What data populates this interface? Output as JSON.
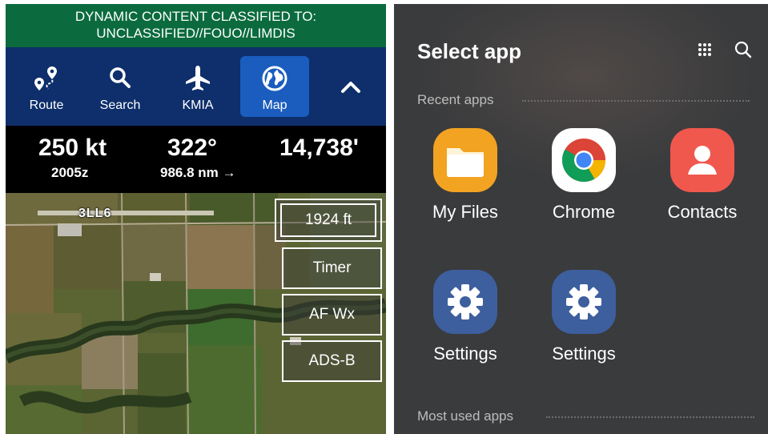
{
  "banner": {
    "line1": "DYNAMIC CONTENT CLASSIFIED TO:",
    "line2": "UNCLASSIFIED//FOUO//LIMDIS"
  },
  "toolbar": {
    "buttons": [
      {
        "label": "Route",
        "icon": "route-icon"
      },
      {
        "label": "Search",
        "icon": "search-icon"
      },
      {
        "label": "KMIA",
        "icon": "airplane-icon"
      },
      {
        "label": "Map",
        "icon": "globe-icon"
      }
    ],
    "collapse_icon": "chevron-up-icon",
    "accent_color": "#1a5dbe",
    "bar_color": "#0e2f6b"
  },
  "stats": {
    "speed": "250 kt",
    "time": "2005z",
    "heading": "322°",
    "distance": "986.8 nm →",
    "altitude": "14,738'"
  },
  "map": {
    "airport_label": "3LL6",
    "buttons": [
      "1924 ft",
      "Timer",
      "AF Wx",
      "ADS-B"
    ]
  },
  "app_picker": {
    "title": "Select app",
    "recent_label": "Recent apps",
    "most_used_label": "Most used apps",
    "apps": [
      {
        "label": "My Files",
        "icon": "folder-icon",
        "color": "#f2a321"
      },
      {
        "label": "Chrome",
        "icon": "chrome-icon",
        "color": "#ffffff"
      },
      {
        "label": "Contacts",
        "icon": "contacts-icon",
        "color": "#f0584d"
      },
      {
        "label": "Settings",
        "icon": "gear-icon",
        "color": "#3d5f9e"
      },
      {
        "label": "Settings",
        "icon": "gear-icon",
        "color": "#3d5f9e"
      }
    ]
  }
}
